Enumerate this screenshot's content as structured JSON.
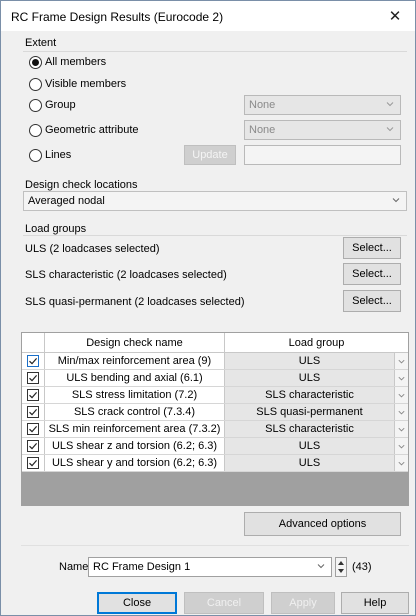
{
  "window": {
    "title": "RC Frame Design Results (Eurocode 2)",
    "close_glyph": "✕"
  },
  "extent": {
    "group_label": "Extent",
    "options": [
      {
        "label": "All members",
        "checked": true
      },
      {
        "label": "Visible members",
        "checked": false
      },
      {
        "label": "Group",
        "checked": false
      },
      {
        "label": "Geometric attribute",
        "checked": false
      },
      {
        "label": "Lines",
        "checked": false
      }
    ],
    "group_combo_value": "None",
    "geo_combo_value": "None",
    "update_label": "Update",
    "lines_value": ""
  },
  "locations": {
    "group_label": "Design check locations",
    "selected": "Averaged nodal"
  },
  "load_groups": {
    "group_label": "Load groups",
    "rows": [
      {
        "label": "ULS (2 loadcases selected)",
        "button": "Select..."
      },
      {
        "label": "SLS characteristic (2 loadcases selected)",
        "button": "Select..."
      },
      {
        "label": "SLS quasi-permanent (2 loadcases selected)",
        "button": "Select..."
      }
    ]
  },
  "checks_table": {
    "col_name": "Design check name",
    "col_group": "Load group",
    "rows": [
      {
        "name": "Min/max reinforcement area (9)",
        "group": "ULS",
        "checked": true,
        "selected": true
      },
      {
        "name": "ULS bending and axial (6.1)",
        "group": "ULS",
        "checked": true,
        "selected": false
      },
      {
        "name": "SLS stress limitation (7.2)",
        "group": "SLS characteristic",
        "checked": true,
        "selected": false
      },
      {
        "name": "SLS crack control (7.3.4)",
        "group": "SLS quasi-permanent",
        "checked": true,
        "selected": false
      },
      {
        "name": "SLS min reinforcement area (7.3.2)",
        "group": "SLS characteristic",
        "checked": true,
        "selected": false
      },
      {
        "name": "ULS shear z and torsion (6.2; 6.3)",
        "group": "ULS",
        "checked": true,
        "selected": false
      },
      {
        "name": "ULS shear y and torsion (6.2; 6.3)",
        "group": "ULS",
        "checked": true,
        "selected": false
      }
    ]
  },
  "advanced_label": "Advanced options",
  "name_row": {
    "label": "Name",
    "value": "RC Frame Design 1",
    "count": "(43)"
  },
  "footer": {
    "close": "Close",
    "cancel": "Cancel",
    "apply": "Apply",
    "help": "Help"
  }
}
